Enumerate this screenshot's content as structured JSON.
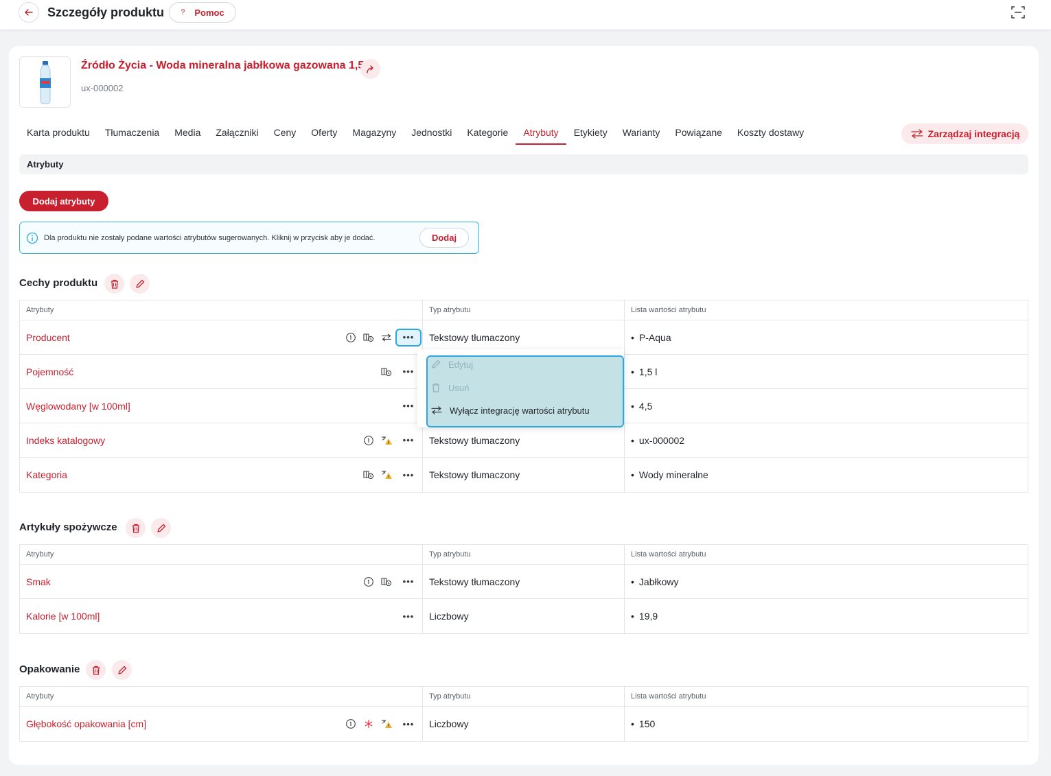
{
  "header": {
    "title": "Szczegóły produktu",
    "help_label": "Pomoc",
    "help_icon": "?"
  },
  "product": {
    "name": "Źródło Życia - Woda mineralna jabłkowa gazowana 1,5l",
    "code": "ux-000002"
  },
  "tabs": [
    {
      "label": "Karta produktu"
    },
    {
      "label": "Tłumaczenia"
    },
    {
      "label": "Media"
    },
    {
      "label": "Załączniki"
    },
    {
      "label": "Ceny"
    },
    {
      "label": "Oferty"
    },
    {
      "label": "Magazyny"
    },
    {
      "label": "Jednostki"
    },
    {
      "label": "Kategorie"
    },
    {
      "label": "Atrybuty",
      "active": true
    },
    {
      "label": "Etykiety"
    },
    {
      "label": "Warianty"
    },
    {
      "label": "Powiązane"
    },
    {
      "label": "Koszty dostawy"
    }
  ],
  "manage_integration_label": "Zarządzaj integracją",
  "section_title": "Atrybuty",
  "add_attributes_label": "Dodaj atrybuty",
  "info": {
    "text": "Dla produktu nie zostały podane wartości atrybutów sugerowanych. Kliknij w przycisk aby je dodać.",
    "button": "Dodaj"
  },
  "table_headers": {
    "attr": "Atrybuty",
    "type": "Typ atrybutu",
    "values": "Lista wartości atrybutu"
  },
  "groups": [
    {
      "title": "Cechy produktu",
      "rows": [
        {
          "name": "Producent",
          "type": "Tekstowy tłumaczony",
          "value": "P-Aqua",
          "icons": [
            "info-icon",
            "translate-icon",
            "integration-icon"
          ],
          "menu_open": true
        },
        {
          "name": "Pojemność",
          "type": "",
          "value": "1,5 l",
          "icons": [
            "translate-icon"
          ]
        },
        {
          "name": "Węglowodany [w 100ml]",
          "type": "",
          "value": "4,5",
          "icons": []
        },
        {
          "name": "Indeks katalogowy",
          "type": "Tekstowy tłumaczony",
          "value": "ux-000002",
          "icons": [
            "info-icon",
            "warning-translate-icon"
          ]
        },
        {
          "name": "Kategoria",
          "type": "Tekstowy tłumaczony",
          "value": "Wody mineralne",
          "icons": [
            "translate-icon",
            "warning-translate-icon"
          ]
        }
      ]
    },
    {
      "title": "Artykuły spożywcze",
      "rows": [
        {
          "name": "Smak",
          "type": "Tekstowy tłumaczony",
          "value": "Jabłkowy",
          "icons": [
            "info-icon",
            "translate-icon"
          ]
        },
        {
          "name": "Kalorie [w 100ml]",
          "type": "Liczbowy",
          "value": "19,9",
          "icons": []
        }
      ]
    },
    {
      "title": "Opakowanie",
      "rows": [
        {
          "name": "Głębokość opakowania [cm]",
          "type": "Liczbowy",
          "value": "150",
          "icons": [
            "info-icon",
            "required-icon",
            "warning-translate-icon"
          ]
        }
      ]
    }
  ],
  "context_menu": {
    "edit": "Edytuj",
    "delete": "Usuń",
    "disable_integration": "Wyłącz integrację wartości atrybutu"
  },
  "colors": {
    "accent": "#c8202e",
    "highlight": "#29a9df"
  }
}
